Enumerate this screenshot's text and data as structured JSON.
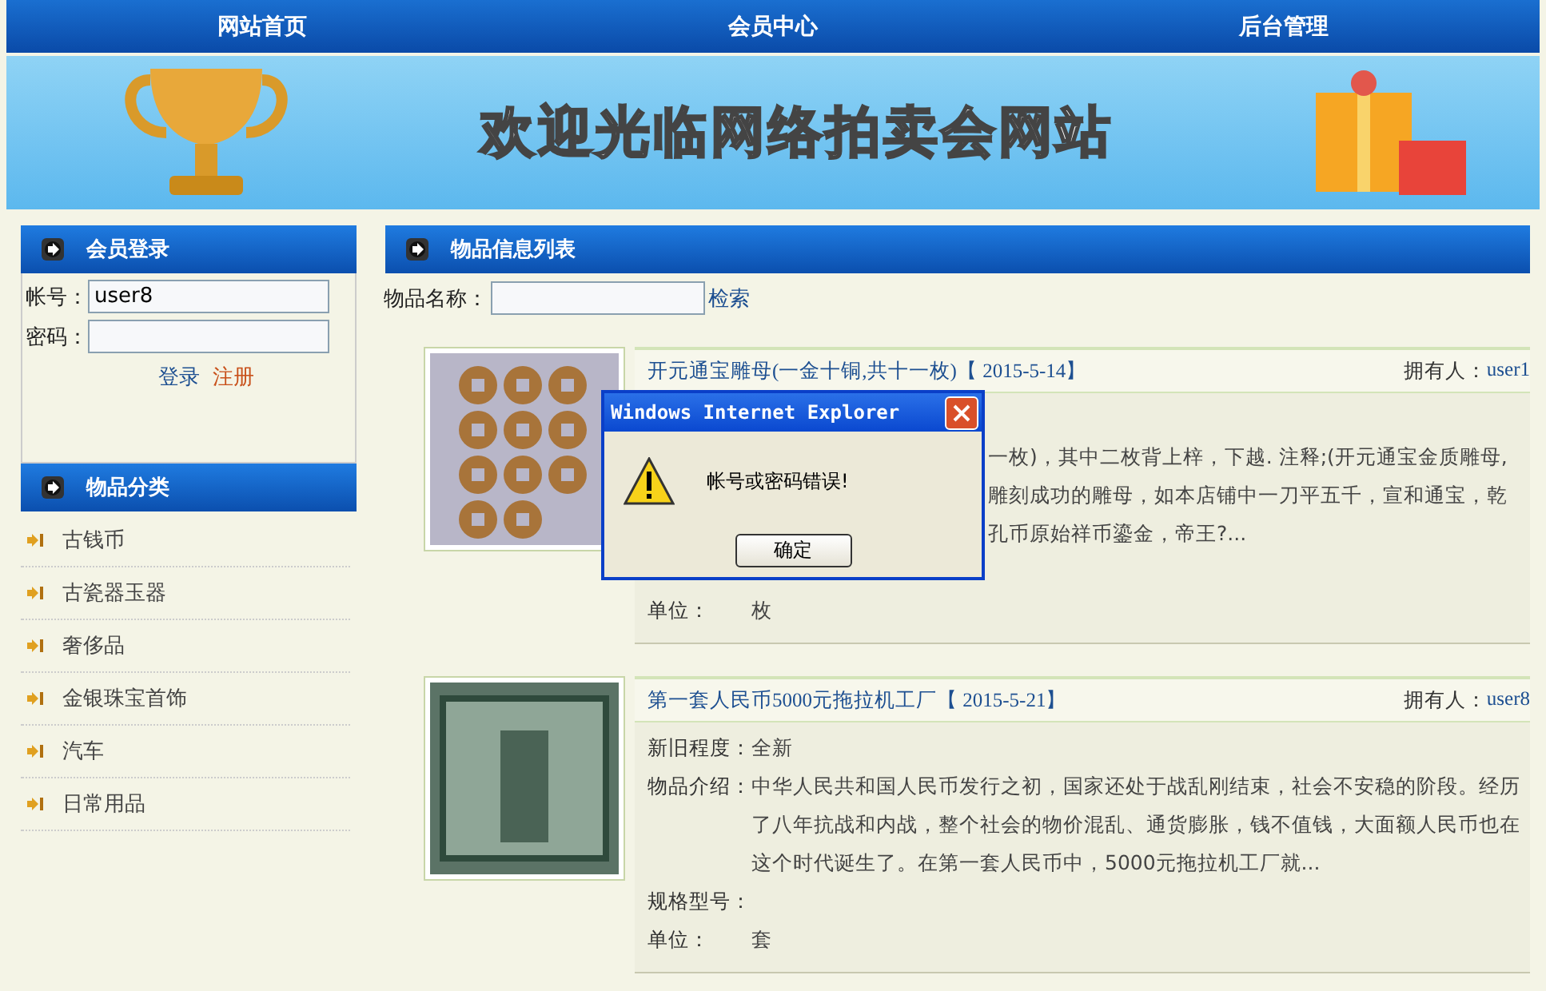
{
  "nav": [
    {
      "label": "网站首页"
    },
    {
      "label": "会员中心"
    },
    {
      "label": "后台管理"
    }
  ],
  "banner": {
    "title": "欢迎光临网络拍卖会网站"
  },
  "login": {
    "title": "会员登录",
    "account_label": "帐号：",
    "account_value": "user8",
    "password_label": "密码：",
    "login_link": "登录",
    "register_link": "注册"
  },
  "categories": {
    "title": "物品分类",
    "items": [
      {
        "label": "古钱币"
      },
      {
        "label": "古瓷器玉器"
      },
      {
        "label": "奢侈品"
      },
      {
        "label": "金银珠宝首饰"
      },
      {
        "label": "汽车"
      },
      {
        "label": "日常用品"
      }
    ]
  },
  "list": {
    "title": "物品信息列表",
    "search_label": "物品名称：",
    "search_button": "检索",
    "items": [
      {
        "photo": {
          "kind": "coins"
        },
        "title": "开元通宝雕母(一金十铜,共十一枚)【",
        "date": "2015-5-14】",
        "owner_label": "拥有人：",
        "owner": "user1",
        "fields": [
          {
            "kind": "covered"
          },
          {
            "kind": "partial",
            "lines": [
              "一枚)，其中二枚背上梓，下越. 注释;(开元通宝金质雕母,",
              "雕刻成功的雕母，如本店铺中一刀平五千，宣和通宝，乾",
              "孔币原始祥币鎏金，帝王?..."
            ]
          },
          {
            "kind": "covered"
          },
          {
            "kind": "text",
            "label": "单位：",
            "lines": [
              "枚"
            ]
          }
        ]
      },
      {
        "photo": {
          "kind": "banknote"
        },
        "title": "第一套人民币5000元拖拉机工厂【",
        "date": "2015-5-21】",
        "owner_label": "拥有人：",
        "owner": "user8",
        "fields": [
          {
            "kind": "text",
            "label": "新旧程度：",
            "lines": [
              "全新"
            ]
          },
          {
            "kind": "text",
            "label": "物品介绍：",
            "lines": [
              "中华人民共和国人民币发行之初，国家还处于战乱刚结束，社会不安稳的阶段。经历",
              "了八年抗战和内战，整个社会的物价混乱、通货膨胀，钱不值钱，大面额人民币也在",
              "这个时代诞生了。在第一套人民币中，5000元拖拉机工厂就..."
            ]
          },
          {
            "kind": "text",
            "label": "规格型号："
          },
          {
            "kind": "text",
            "label": "单位：",
            "lines": [
              "套"
            ]
          }
        ]
      }
    ]
  },
  "dialog": {
    "title": "Windows Internet Explorer",
    "message": "帐号或密码错误!",
    "button": "确定"
  }
}
